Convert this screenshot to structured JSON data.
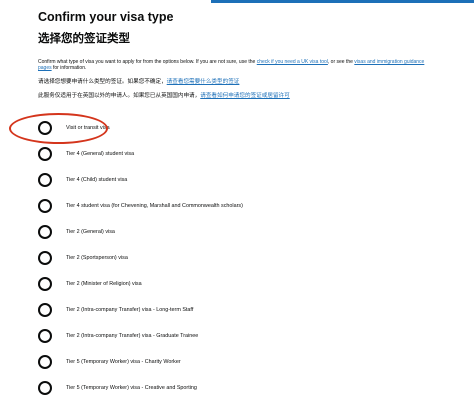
{
  "header": {
    "title_en": "Confirm your visa type",
    "title_zh": "选择您的签证类型"
  },
  "intro": {
    "text_1": "Confirm what type of visa you want to apply for from the options below. If you are not sure, use the ",
    "link_1": "check if you need a UK visa tool",
    "text_2": ", or see the ",
    "link_2": "visas and immigration guidance pages",
    "text_3": " for information."
  },
  "zh_help": {
    "line1_text": "请选择您想要申请什么类型的签证。如果您不确定，",
    "line1_link": "请查看您需要什么类型的签证",
    "line2_text": "此服务仅适用于在英国以外的申请人。如果您已从英国国内申请，",
    "line2_link": "请查看如何申请您的签证或居留许可"
  },
  "visa_options": [
    {
      "label": "Visit or transit visa"
    },
    {
      "label": "Tier 4 (General) student visa"
    },
    {
      "label": "Tier 4 (Child) student visa"
    },
    {
      "label": "Tier 4 student visa (for Chevening, Marshall and Commonwealth scholars)"
    },
    {
      "label": "Tier 2 (General) visa"
    },
    {
      "label": "Tier 2 (Sportsperson) visa"
    },
    {
      "label": "Tier 2 (Minister of Religion) visa"
    },
    {
      "label": "Tier 2 (Intra-company Transfer) visa - Long-term Staff"
    },
    {
      "label": "Tier 2 (Intra-company Transfer) visa - Graduate Trainee"
    },
    {
      "label": "Tier 5 (Temporary Worker) visa - Charity Worker"
    },
    {
      "label": "Tier 5 (Temporary Worker) visa - Creative and Sporting"
    }
  ],
  "colors": {
    "link": "#1d70b8",
    "highlight": "#d4351c",
    "text": "#0b0c0c"
  }
}
